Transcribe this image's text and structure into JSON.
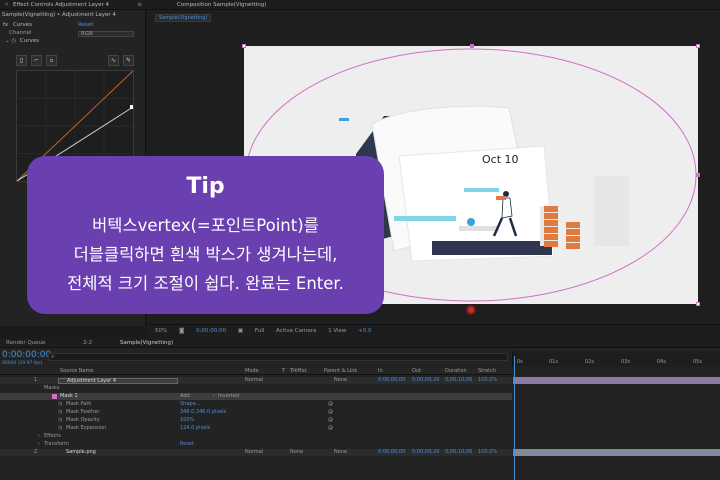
{
  "effect_controls": {
    "tab_label": "Effect Controls Adjustment Layer 4",
    "breadcrumb": "Sample(Vignetting) • Adjustment Layer 4",
    "effect_name": "Curves",
    "reset_label": "Reset",
    "channel_label": "Channel",
    "channel_value": "RGB",
    "curves_label": "Curves"
  },
  "composition": {
    "tab_label": "Composition Sample(Vignetting)",
    "sub_tab": "Sample(Vignetting)",
    "calendar_text": "Oct 10",
    "footer": {
      "zoom": "50%",
      "timecode": "0;00;00;00",
      "resolution": "Full",
      "camera": "Active Camera",
      "views": "1 View",
      "offset": "+0.0"
    }
  },
  "tip": {
    "title": "Tip",
    "line1": "버텍스vertex(=포인트Point)를",
    "line2": "더블클릭하면 흰색 박스가 생겨나는데,",
    "line3": "전체적 크기 조절이 쉽다. 완료는 Enter."
  },
  "timeline": {
    "tabs": [
      "Render Queue",
      "2-2",
      "Sample(Vignetting)"
    ],
    "timecode": "0:00:00:00",
    "fps": "00000 (29.97 fps)",
    "columns": [
      "Source Name",
      "Mode",
      "T",
      "TrkMat",
      "Parent & Link",
      "In",
      "Out",
      "Duration",
      "Stretch"
    ],
    "ruler": [
      "0s",
      "01s",
      "02s",
      "03s",
      "04s",
      "05s"
    ],
    "layer1": {
      "number": "1",
      "name": "Adjustment Layer 4",
      "mode": "Normal",
      "parent": "None",
      "in": "0;00;00;00",
      "out": "0;00;09;29",
      "duration": "0;00;10;00",
      "stretch": "100.0%"
    },
    "masks_label": "Masks",
    "mask1_label": "Mask 1",
    "mask1_mode": "Add",
    "mask1_invert": "Inverted",
    "mask_path_label": "Mask Path",
    "mask_path_value": "Shape...",
    "mask_feather_label": "Mask Feather",
    "mask_feather_value": "346.0,346.0 pixels",
    "mask_opacity_label": "Mask Opacity",
    "mask_opacity_value": "100%",
    "mask_expansion_label": "Mask Expansion",
    "mask_expansion_value": "124.0 pixels",
    "effects_label": "Effects",
    "transform_label": "Transform",
    "transform_reset": "Reset",
    "layer2": {
      "number": "2",
      "name": "Sample.png",
      "mode": "Normal",
      "trkmat": "None",
      "parent": "None",
      "in": "0;00;00;00",
      "out": "0;00;09;29",
      "duration": "0;00;10;00",
      "stretch": "100.0%"
    }
  }
}
